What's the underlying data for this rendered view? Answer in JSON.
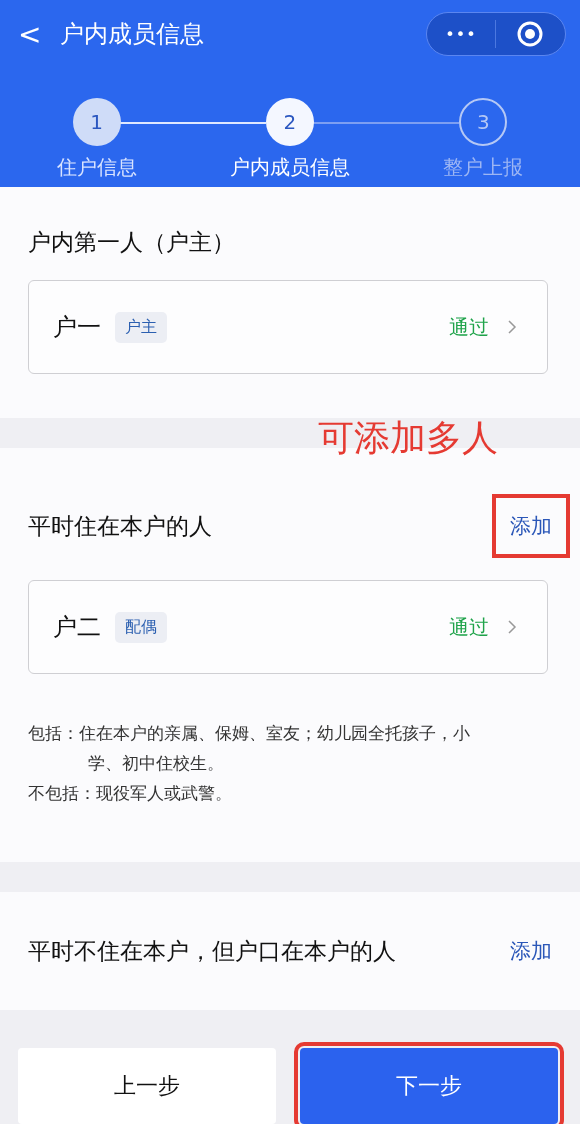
{
  "header": {
    "back": "<",
    "title": "户内成员信息",
    "menu": "•••"
  },
  "steps": [
    {
      "number": "1",
      "label": "住户信息",
      "kind": "done"
    },
    {
      "number": "2",
      "label": "户内成员信息",
      "kind": "current"
    },
    {
      "number": "3",
      "label": "整户上报",
      "kind": "todo"
    }
  ],
  "sections": [
    {
      "title": "户内第一人（户主）",
      "members": [
        {
          "name": "户一",
          "tag": "户主",
          "status": "通过"
        }
      ]
    },
    {
      "title": "平时住在本户的人",
      "add": {
        "label": "添加",
        "highlighted": true
      },
      "annotation": "可添加多人",
      "members": [
        {
          "name": "户二",
          "tag": "配偶",
          "status": "通过"
        }
      ],
      "notes": [
        "包括：住在本户的亲属、保姆、室友；幼儿园全托孩子，小学、初中住校生。",
        "不包括：现役军人或武警。"
      ]
    },
    {
      "title": "平时不住在本户，但户口在本户的人",
      "add": {
        "label": "添加",
        "highlighted": false
      }
    }
  ],
  "footer": {
    "prev": {
      "label": "上一步",
      "highlighted": false
    },
    "next": {
      "label": "下一步",
      "highlighted": true
    }
  }
}
